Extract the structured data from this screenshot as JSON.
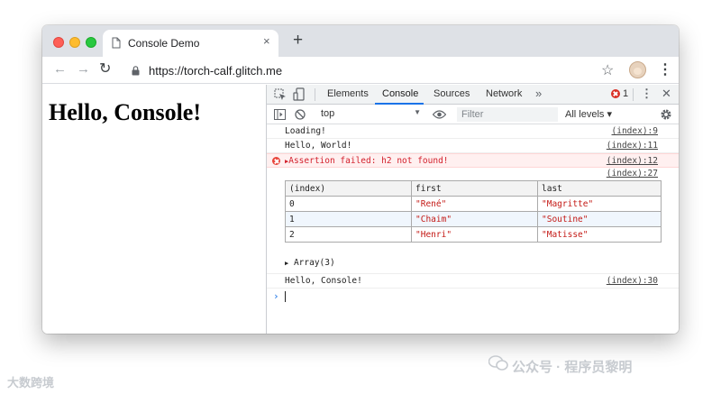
{
  "browser": {
    "tab_title": "Console Demo",
    "tab_close": "×",
    "new_tab": "+",
    "url": "https://torch-calf.glitch.me",
    "back": "←",
    "forward": "→",
    "reload": "↻",
    "star": "☆",
    "menu": "⋮"
  },
  "page": {
    "heading": "Hello, Console!"
  },
  "devtools": {
    "tabs": [
      "Elements",
      "Console",
      "Sources",
      "Network"
    ],
    "active_tab": "Console",
    "more_tabs": "»",
    "error_count": "1",
    "menu": "⋮",
    "close": "✕",
    "context": "top",
    "filter_placeholder": "Filter",
    "levels": "All levels ▾",
    "console": {
      "messages": [
        {
          "text": "Loading!",
          "source": "(index):9"
        },
        {
          "text": "Hello, World!",
          "source": "(index):11"
        },
        {
          "text": "Assertion failed: h2 not found!",
          "source": "(index):12",
          "level": "error"
        },
        {
          "text": "",
          "source": "(index):27"
        }
      ],
      "table": {
        "headers": [
          "(index)",
          "first",
          "last"
        ],
        "rows": [
          [
            "0",
            "\"René\"",
            "\"Magritte\""
          ],
          [
            "1",
            "\"Chaim\"",
            "\"Soutine\""
          ],
          [
            "2",
            "\"Henri\"",
            "\"Matisse\""
          ]
        ]
      },
      "array_summary": "Array(3)",
      "final_message": {
        "text": "Hello, Console!",
        "source": "(index):30"
      },
      "prompt": "›"
    }
  },
  "watermarks": {
    "left": "大数跨境",
    "right": "公众号 · 程序员黎明"
  },
  "colors": {
    "accent": "#1a73e8",
    "error": "#d3212d",
    "string": "#c41a16"
  }
}
